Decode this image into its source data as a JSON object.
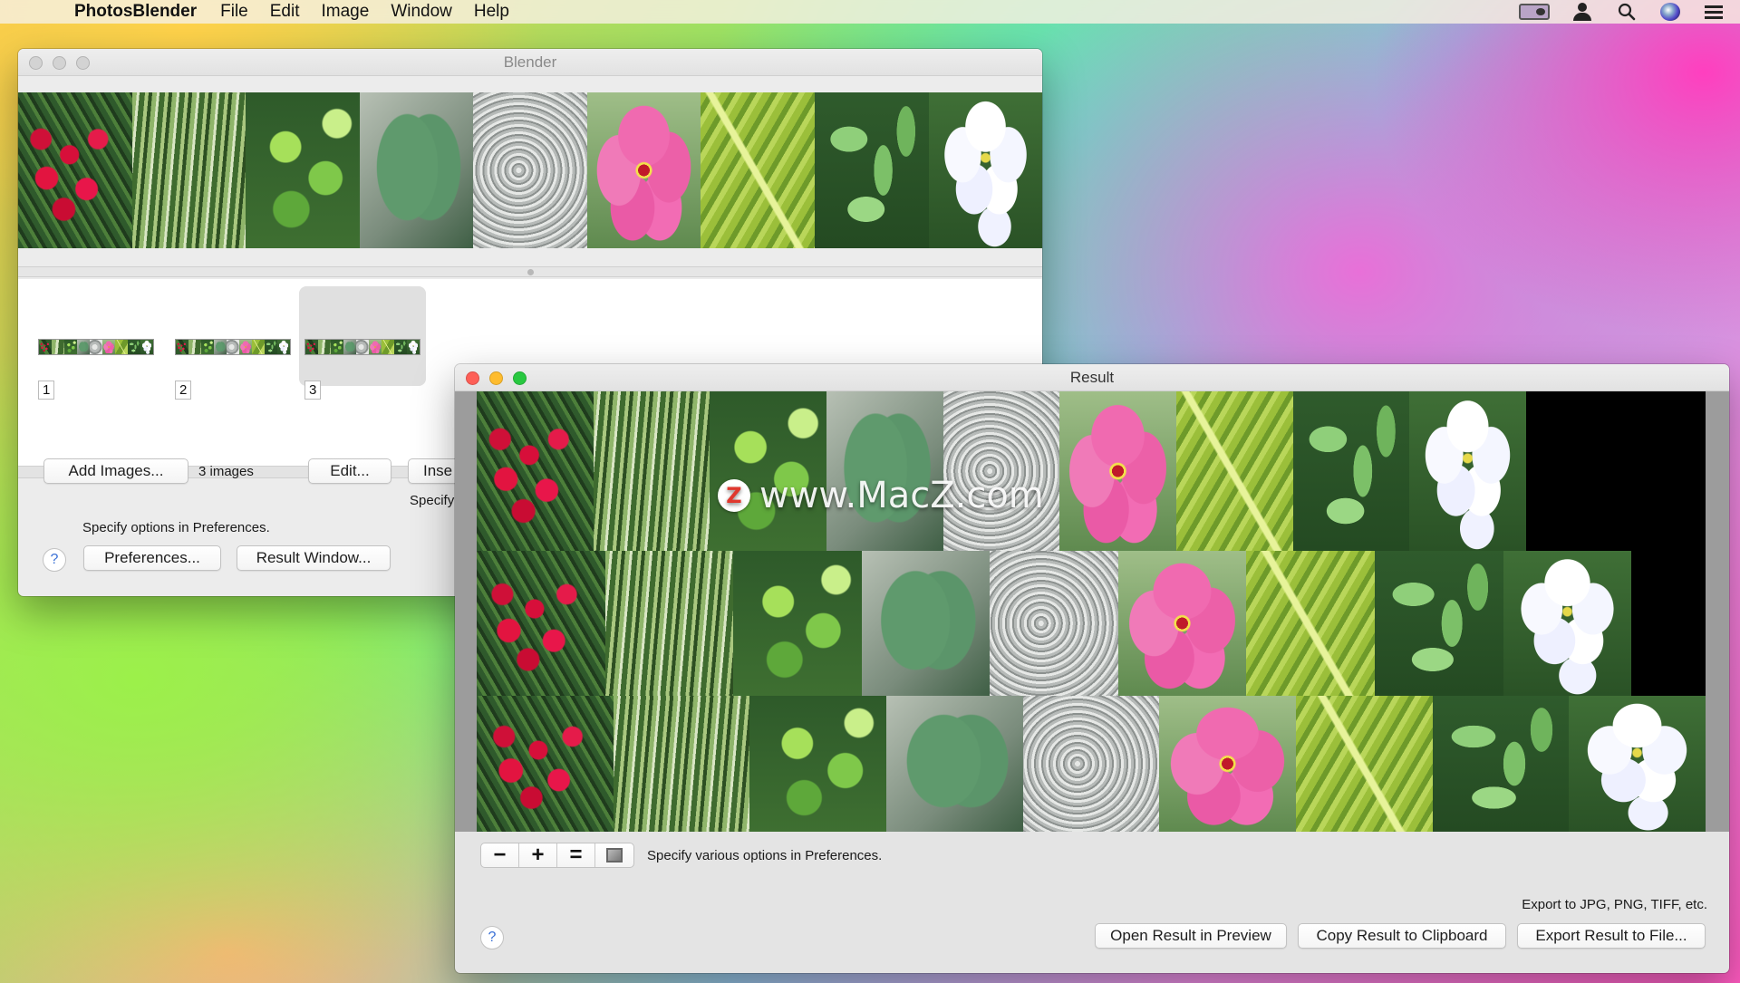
{
  "menubar": {
    "app_name": "PhotosBlender",
    "items": [
      "File",
      "Edit",
      "Image",
      "Window",
      "Help"
    ],
    "status_icons": [
      "display-icon",
      "user-icon",
      "spotlight-search-icon",
      "siri-icon",
      "notification-center-icon"
    ]
  },
  "blender": {
    "title": "Blender",
    "thumbnails": [
      {
        "number": "1",
        "selected": false
      },
      {
        "number": "2",
        "selected": false
      },
      {
        "number": "3",
        "selected": true
      }
    ],
    "add_images_label": "Add Images...",
    "image_count": "3 images",
    "edit_label": "Edit...",
    "insert_label": "Inse",
    "specify_partial": "Specify",
    "specify_options": "Specify options in Preferences.",
    "preferences_label": "Preferences...",
    "result_window_label": "Result Window...",
    "help_label": "?"
  },
  "result": {
    "title": "Result",
    "watermark_logo": "Z",
    "watermark_text": "www.MacZ.com",
    "zoom_out": "−",
    "zoom_in": "+",
    "zoom_actual": "=",
    "toolbar_hint": "Specify various options in Preferences.",
    "export_hint": "Export to JPG, PNG, TIFF, etc.",
    "open_preview_label": "Open Result in Preview",
    "copy_clipboard_label": "Copy Result to Clipboard",
    "export_file_label": "Export Result to File...",
    "help_label": "?"
  },
  "colors": {
    "close": "#fe5f57",
    "minimize": "#febc2e",
    "zoom": "#28c840",
    "help_accent": "#3a70d6"
  }
}
